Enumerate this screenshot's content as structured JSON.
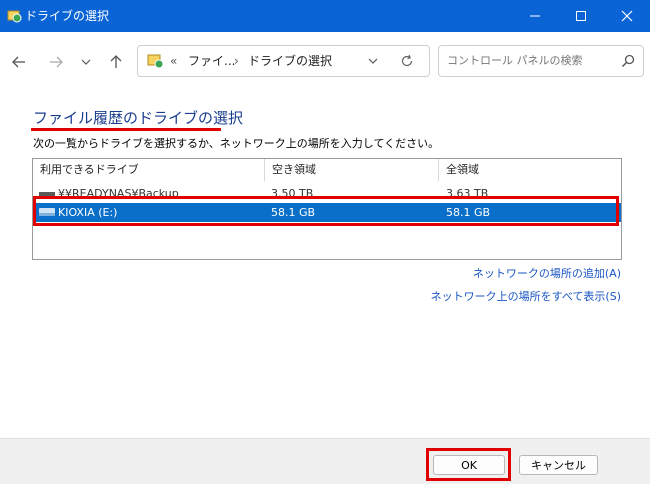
{
  "window": {
    "title": "ドライブの選択",
    "accent_color": "#0a64d6",
    "controls": [
      "minimize-icon",
      "maximize-icon",
      "close-icon"
    ]
  },
  "nav": {
    "back_icon": "back-arrow-icon",
    "forward_icon": "forward-arrow-icon",
    "recent_icon": "chevron-down-icon",
    "up_icon": "up-arrow-icon"
  },
  "address": {
    "overflow": "«",
    "segments": [
      "ファイ...",
      "ドライブの選択"
    ],
    "separator": "›",
    "dropdown_icon": "chevron-down-icon",
    "refresh_icon": "refresh-icon"
  },
  "search": {
    "placeholder": "コントロール パネルの検索",
    "icon": "search-icon"
  },
  "content": {
    "heading": "ファイル履歴のドライブの選択",
    "instruction": "次の一覧からドライブを選択するか、ネットワーク上の場所を入力してください。"
  },
  "table": {
    "headers": [
      "利用できるドライブ",
      "空き領域",
      "全領域"
    ],
    "rows": [
      {
        "name": "¥¥READYNAS¥Backup",
        "free": "3.50 TB",
        "total": "3.63 TB",
        "selected": false
      },
      {
        "name": "KIOXIA (E:)",
        "free": "58.1 GB",
        "total": "58.1 GB",
        "selected": true
      }
    ],
    "selection_color": "#0a6fc9"
  },
  "links": {
    "add_network": "ネットワークの場所の追加(A)",
    "show_all": "ネットワーク上の場所をすべて表示(S)"
  },
  "buttons": {
    "ok": "OK",
    "cancel": "キャンセル"
  },
  "highlight_color": "#e00000"
}
